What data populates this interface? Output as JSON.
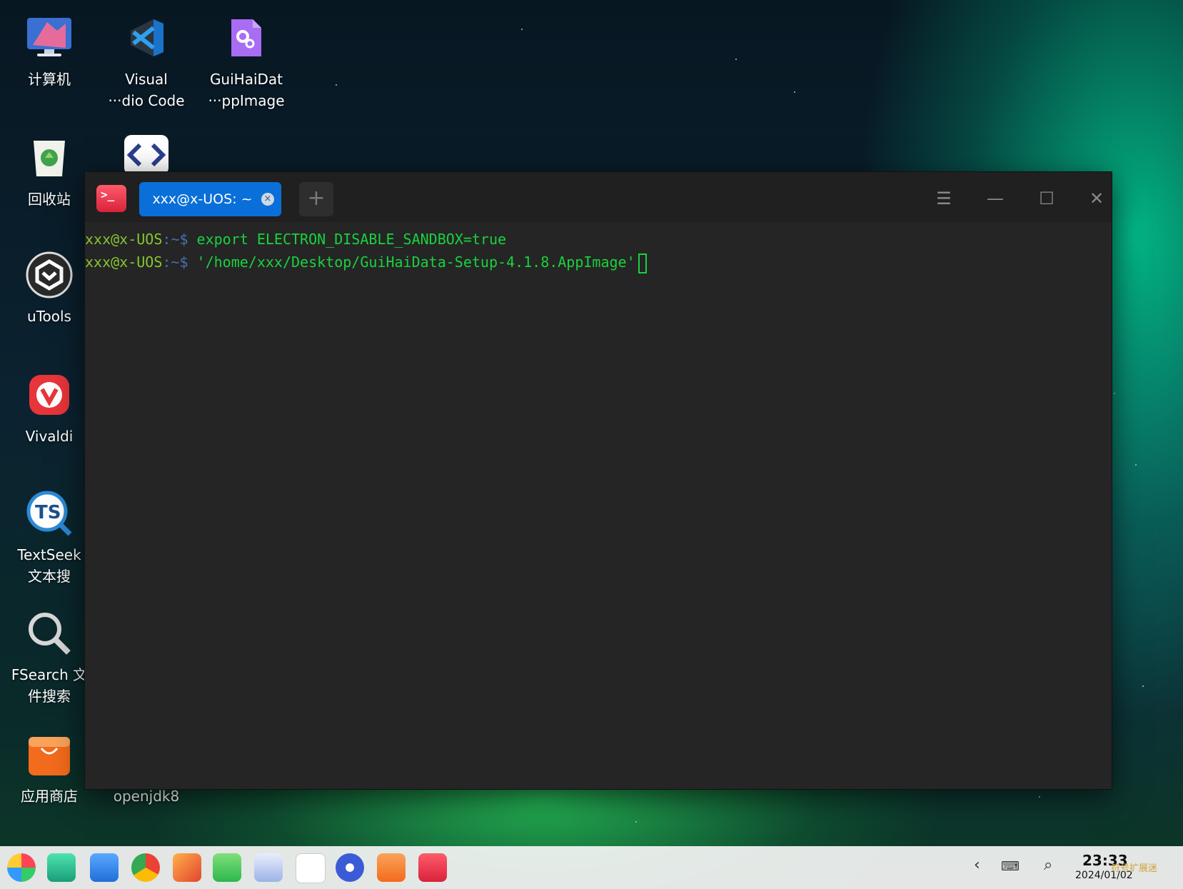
{
  "desktop": {
    "icons": [
      {
        "name": "computer",
        "label": "计算机"
      },
      {
        "name": "vscode",
        "label": "Visual\n···dio Code"
      },
      {
        "name": "guihaidata",
        "label": "GuiHaiDat\n···ppImage"
      },
      {
        "name": "trash",
        "label": "回收站"
      },
      {
        "name": "utools",
        "label": "uTools"
      },
      {
        "name": "vivaldi",
        "label": "Vivaldi"
      },
      {
        "name": "textseek",
        "label": "TextSeek\n文本搜"
      },
      {
        "name": "fsearch",
        "label": "FSearch 文\n件搜索"
      },
      {
        "name": "appstore",
        "label": "应用商店"
      },
      {
        "name": "openjdk8",
        "label": "openjdk8"
      }
    ]
  },
  "terminal": {
    "tab_title": "xxx@x-UOS: ~",
    "tab_close": "×",
    "new_tab": "+",
    "app_glyph": ">_",
    "lines": [
      {
        "user": "xxx@x-UOS",
        "sep": ":~$ ",
        "cmd": "export ELECTRON_DISABLE_SANDBOX=true"
      },
      {
        "user": "xxx@x-UOS",
        "sep": ":~$ ",
        "cmd": "'/home/xxx/Desktop/GuiHaiData-Setup-4.1.8.AppImage'"
      }
    ],
    "window_buttons": {
      "menu": "☰",
      "minimize": "—",
      "maximize": "☐",
      "close": "✕"
    }
  },
  "taskbar": {
    "clock_time": "23:33",
    "clock_date": "2024/01/02",
    "watermark": "符号扩展迷",
    "icons": [
      "launcher-icon",
      "multitask-icon",
      "file-manager-icon",
      "chrome-icon",
      "image-viewer-icon",
      "music-icon",
      "contacts-icon",
      "calendar-icon",
      "settings-icon",
      "app-store-icon",
      "terminal-icon"
    ]
  },
  "colors": {
    "terminal_bg": "#252525",
    "prompt_user": "#86c630",
    "command": "#19d23e",
    "tab_active": "#0a6fd8"
  }
}
